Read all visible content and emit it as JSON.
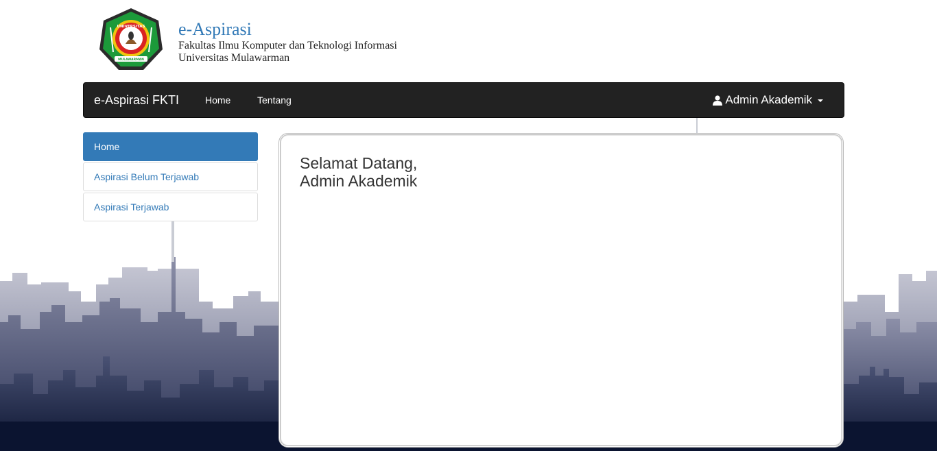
{
  "header": {
    "title": "e-Aspirasi",
    "subtitle_line1": "Fakultas Ilmu Komputer dan Teknologi Informasi",
    "subtitle_line2": "Universitas Mulawarman",
    "logo_icon": "university-seal-logo",
    "logo_text_top": "UNIVERSITAS",
    "logo_text_bottom": "MULAWARMAN"
  },
  "navbar": {
    "brand": "e-Aspirasi FKTI",
    "links": [
      "Home",
      "Tentang"
    ],
    "user_label": "Admin Akademik",
    "user_icon": "user-icon",
    "caret_icon": "caret-down-icon"
  },
  "sidebar": {
    "items": [
      {
        "label": "Home",
        "active": true
      },
      {
        "label": "Aspirasi Belum Terjawab",
        "active": false
      },
      {
        "label": "Aspirasi Terjawab",
        "active": false
      }
    ]
  },
  "main": {
    "welcome_line1": "Selamat Datang,",
    "welcome_line2": "Admin Akademik"
  },
  "colors": {
    "primary": "#337ab7",
    "navbar_bg": "#222222",
    "skyline_dark": "#0b1430",
    "skyline_light": "#c7c8d6"
  }
}
